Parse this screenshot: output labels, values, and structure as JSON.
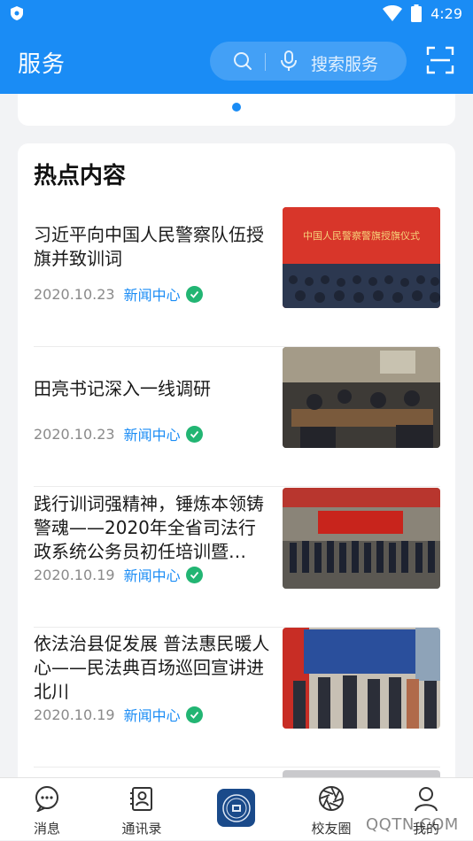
{
  "status_bar": {
    "time": "4:29"
  },
  "header": {
    "title": "服务",
    "search_placeholder": "搜索服务"
  },
  "section": {
    "title": "热点内容"
  },
  "news": [
    {
      "title": "习近平向中国人民警察队伍授旗并致训词",
      "date": "2020.10.23",
      "source": "新闻中心",
      "thumb_caption": "中国人民警察警旗授旗仪式"
    },
    {
      "title": "田亮书记深入一线调研",
      "date": "2020.10.23",
      "source": "新闻中心"
    },
    {
      "title": "践行训词强精神，锤炼本领铸警魂——2020年全省司法行政系统公务员初任培训暨…",
      "date": "2020.10.19",
      "source": "新闻中心"
    },
    {
      "title": "依法治县促发展 普法惠民暖人心——民法典百场巡回宣讲进北川",
      "date": "2020.10.19",
      "source": "新闻中心"
    }
  ],
  "tabbar": {
    "items": [
      {
        "label": "消息",
        "icon": "chat-icon"
      },
      {
        "label": "通讯录",
        "icon": "contacts-icon"
      },
      {
        "label": "",
        "icon": "emblem-icon"
      },
      {
        "label": "校友圈",
        "icon": "aperture-icon"
      },
      {
        "label": "我的",
        "icon": "user-icon"
      }
    ]
  },
  "watermark": "QQTN.COM",
  "colors": {
    "primary": "#1a8cf5",
    "verified": "#22b573",
    "date": "#8a8a8a"
  }
}
